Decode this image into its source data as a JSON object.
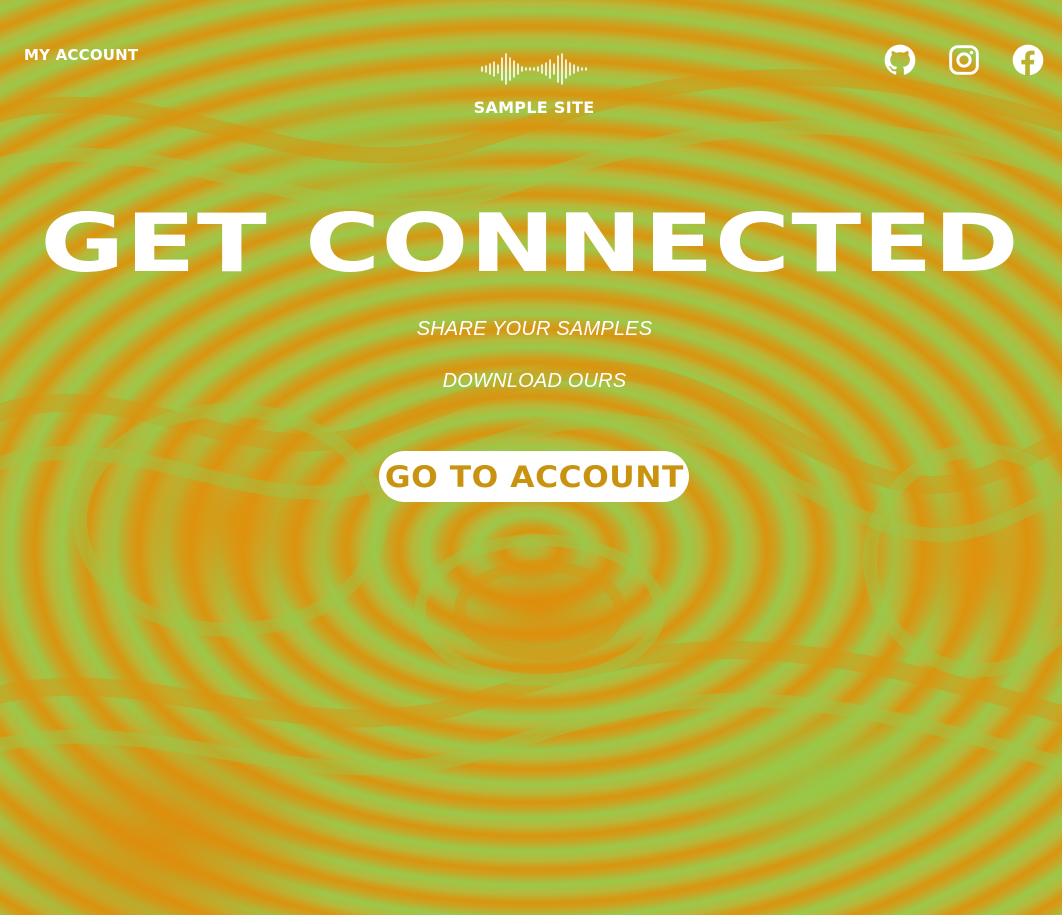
{
  "nav": {
    "account_link": "MY ACCOUNT"
  },
  "brand": {
    "name": "SAMPLE SITE",
    "logo_icon": "sound-wave-icon"
  },
  "socials": [
    {
      "name": "GitHub",
      "icon": "github-icon"
    },
    {
      "name": "Instagram",
      "icon": "instagram-icon"
    },
    {
      "name": "Facebook",
      "icon": "facebook-icon"
    }
  ],
  "hero": {
    "headline": "GET CONNECTED",
    "line1": "SHARE YOUR SAMPLES",
    "line2": "DOWNLOAD OURS",
    "cta_label": "GO TO ACCOUNT"
  },
  "colors": {
    "text": "#ffffff",
    "cta_text": "#c9920f",
    "background_green": "#9cc84a",
    "background_orange": "#d9950f"
  }
}
